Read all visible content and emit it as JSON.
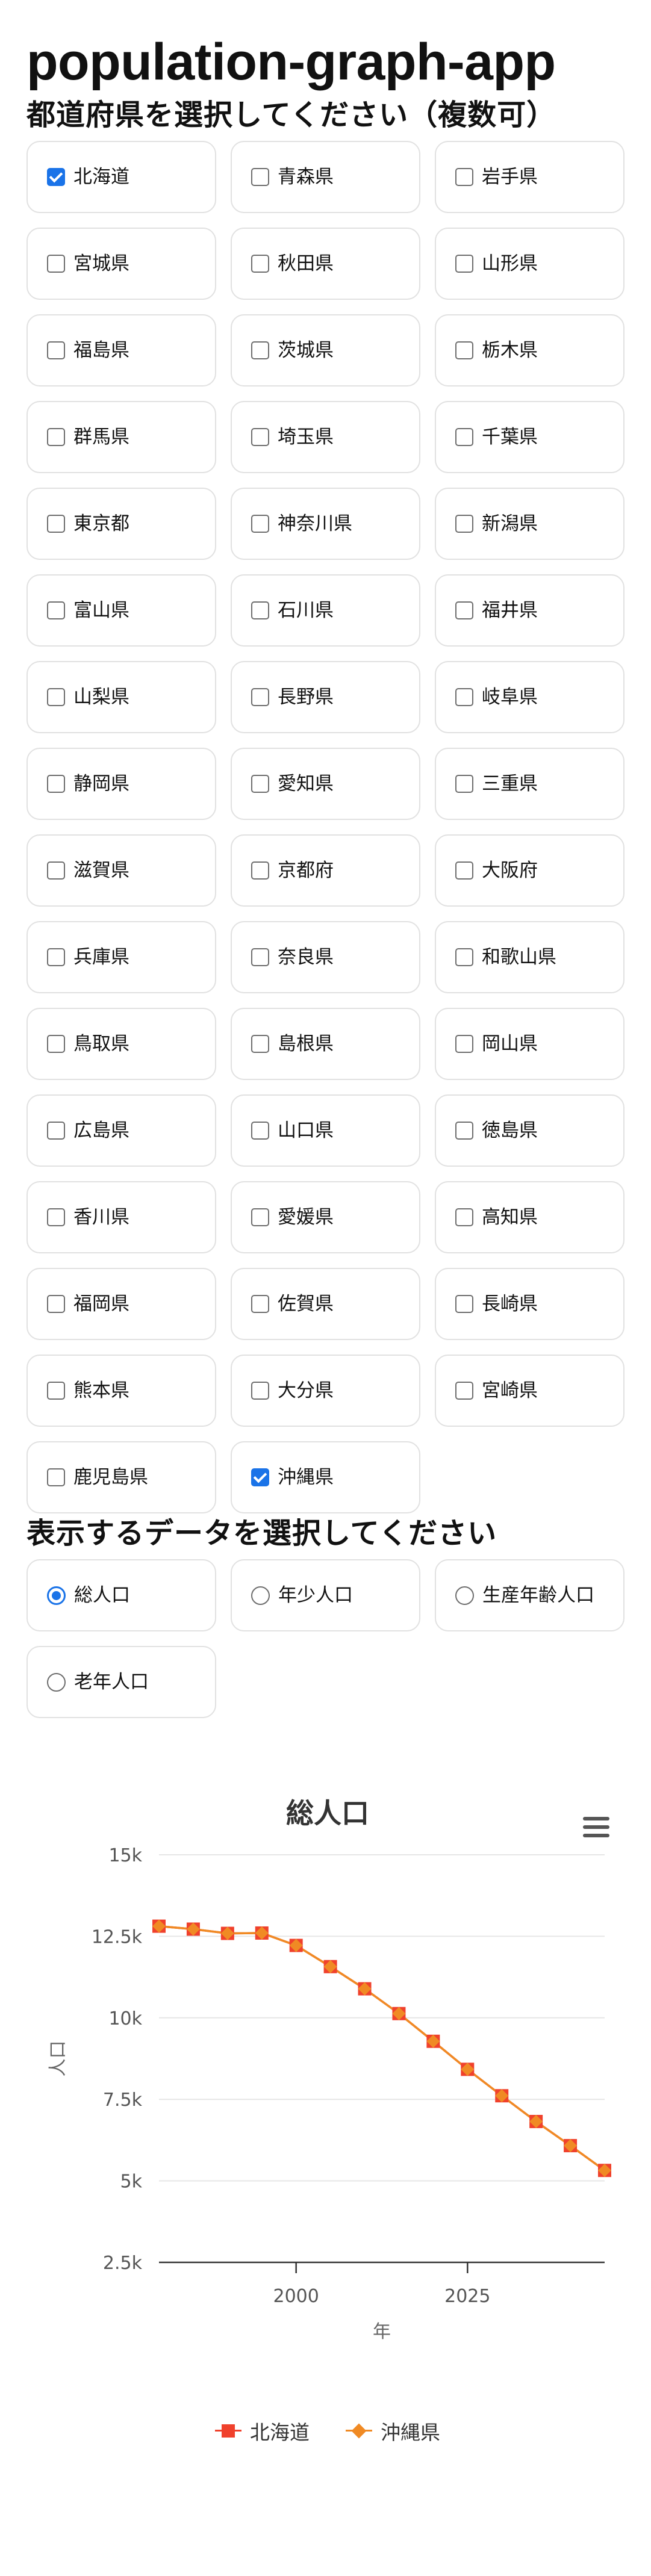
{
  "app_title": "population-graph-app",
  "prefectures": {
    "heading": "都道府県を選択してください（複数可）",
    "items": [
      {
        "label": "北海道",
        "checked": true
      },
      {
        "label": "青森県",
        "checked": false
      },
      {
        "label": "岩手県",
        "checked": false
      },
      {
        "label": "宮城県",
        "checked": false
      },
      {
        "label": "秋田県",
        "checked": false
      },
      {
        "label": "山形県",
        "checked": false
      },
      {
        "label": "福島県",
        "checked": false
      },
      {
        "label": "茨城県",
        "checked": false
      },
      {
        "label": "栃木県",
        "checked": false
      },
      {
        "label": "群馬県",
        "checked": false
      },
      {
        "label": "埼玉県",
        "checked": false
      },
      {
        "label": "千葉県",
        "checked": false
      },
      {
        "label": "東京都",
        "checked": false
      },
      {
        "label": "神奈川県",
        "checked": false
      },
      {
        "label": "新潟県",
        "checked": false
      },
      {
        "label": "富山県",
        "checked": false
      },
      {
        "label": "石川県",
        "checked": false
      },
      {
        "label": "福井県",
        "checked": false
      },
      {
        "label": "山梨県",
        "checked": false
      },
      {
        "label": "長野県",
        "checked": false
      },
      {
        "label": "岐阜県",
        "checked": false
      },
      {
        "label": "静岡県",
        "checked": false
      },
      {
        "label": "愛知県",
        "checked": false
      },
      {
        "label": "三重県",
        "checked": false
      },
      {
        "label": "滋賀県",
        "checked": false
      },
      {
        "label": "京都府",
        "checked": false
      },
      {
        "label": "大阪府",
        "checked": false
      },
      {
        "label": "兵庫県",
        "checked": false
      },
      {
        "label": "奈良県",
        "checked": false
      },
      {
        "label": "和歌山県",
        "checked": false
      },
      {
        "label": "鳥取県",
        "checked": false
      },
      {
        "label": "島根県",
        "checked": false
      },
      {
        "label": "岡山県",
        "checked": false
      },
      {
        "label": "広島県",
        "checked": false
      },
      {
        "label": "山口県",
        "checked": false
      },
      {
        "label": "徳島県",
        "checked": false
      },
      {
        "label": "香川県",
        "checked": false
      },
      {
        "label": "愛媛県",
        "checked": false
      },
      {
        "label": "高知県",
        "checked": false
      },
      {
        "label": "福岡県",
        "checked": false
      },
      {
        "label": "佐賀県",
        "checked": false
      },
      {
        "label": "長崎県",
        "checked": false
      },
      {
        "label": "熊本県",
        "checked": false
      },
      {
        "label": "大分県",
        "checked": false
      },
      {
        "label": "宮崎県",
        "checked": false
      },
      {
        "label": "鹿児島県",
        "checked": false
      },
      {
        "label": "沖縄県",
        "checked": true
      }
    ]
  },
  "data_types": {
    "heading": "表示するデータを選択してください",
    "options": [
      {
        "label": "総人口",
        "selected": true
      },
      {
        "label": "年少人口",
        "selected": false
      },
      {
        "label": "生産年齢人口",
        "selected": false
      },
      {
        "label": "老年人口",
        "selected": false
      }
    ]
  },
  "chart_menu_icon": "hamburger-menu-icon",
  "chart_data": {
    "type": "line",
    "title": "総人口",
    "xlabel": "年",
    "ylabel": "人口",
    "ylim": [
      2500,
      15000
    ],
    "yticks": [
      2500,
      5000,
      7500,
      10000,
      12500,
      15000
    ],
    "ytick_labels": [
      "2.5k",
      "5k",
      "7.5k",
      "10k",
      "12.5k",
      "15k"
    ],
    "xlim": [
      1980,
      2045
    ],
    "xticks": [
      2000,
      2025
    ],
    "xtick_labels": [
      "2000",
      "2025"
    ],
    "grid": true,
    "legend_position": "bottom-center",
    "x": [
      1980,
      1985,
      1990,
      1995,
      2000,
      2005,
      2010,
      2015,
      2020,
      2025,
      2030,
      2035,
      2040,
      2045
    ],
    "series": [
      {
        "name": "北海道",
        "color": "#f0412c",
        "marker": "square",
        "values": [
          12810,
          12720,
          12590,
          12600,
          12220,
          11570,
          10890,
          10130,
          9280,
          8420,
          7610,
          6820,
          6080,
          5320
        ]
      },
      {
        "name": "沖縄県",
        "color": "#f08a24",
        "marker": "diamond",
        "values": [
          12810,
          12720,
          12590,
          12600,
          12220,
          11570,
          10890,
          10130,
          9280,
          8420,
          7610,
          6820,
          6080,
          5320
        ]
      }
    ]
  }
}
